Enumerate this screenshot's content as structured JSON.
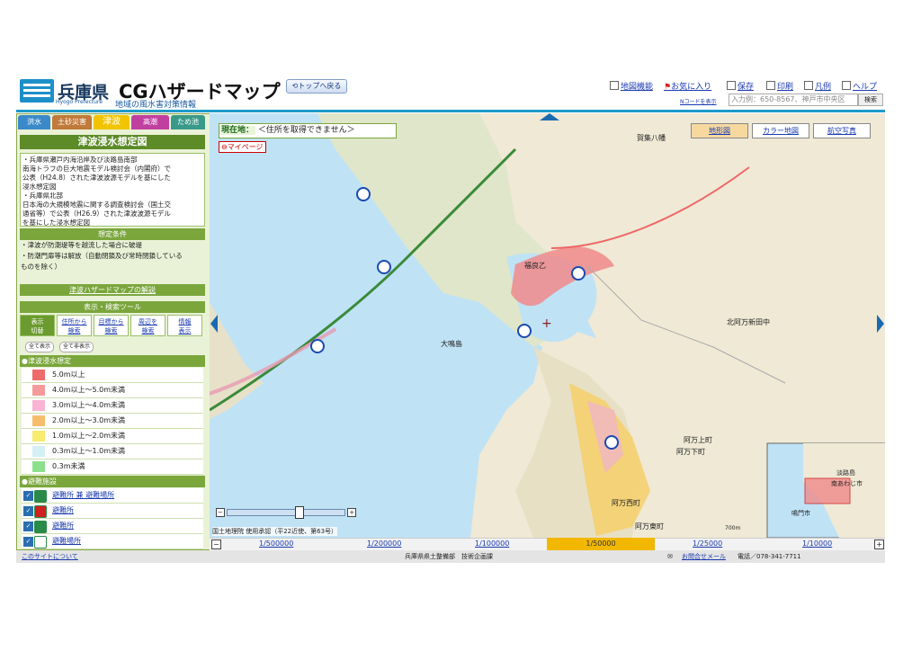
{
  "header": {
    "pref_name": "兵庫県",
    "app_title": "CGハザードマップ",
    "app_subtitle": "地域の風水害対策情報",
    "hyogo_en": "Hyogo Prefecture",
    "top_button": "トップへ戻る",
    "menu": [
      "地図機能",
      "お気に入り",
      "保存",
      "印刷",
      "凡例",
      "ヘルプ"
    ],
    "ncode_link": "Nコードを表示",
    "address_placeholder": "入力例：650-8567、神戸市中央区",
    "search_button": "検索"
  },
  "hazard_tabs": [
    "洪水",
    "土砂災害",
    "津波",
    "高潮",
    "ため池"
  ],
  "panel": {
    "title": "津波浸水想定図",
    "description": [
      "・兵庫県瀬戸内海沿岸及び淡路島南部",
      "南海トラフの巨大地震モデル検討会（内閣府）で",
      "公表（H24.8）された津波波源モデルを基にした",
      "浸水想定図",
      "・兵庫県北部",
      "日本海の大規模地震に関する調査検討会（国土交",
      "通省等）で公表（H26.9）された津波波源モデル",
      "を基にした浸水想定図"
    ],
    "conditions_header": "想定条件",
    "conditions": [
      "・津波が防潮堤等を越流した場合に破堤",
      "・防潮門扉等は解放（自動閉鎖及び常時閉鎖している",
      "ものを除く）"
    ],
    "explain_link": "津波ハザードマップの解説",
    "tools_header": "表示・検索ツール",
    "tools": [
      "表示\n切替",
      "住所から\n検索",
      "目標から\n検索",
      "周辺を\n検索",
      "情報\n表示"
    ],
    "show_all": "全て表示",
    "hide_all": "全て非表示",
    "legend_title": "●津波浸水想定",
    "legend": [
      {
        "label": "5.0m以上",
        "color": "#ee6b6b"
      },
      {
        "label": "4.0m以上～5.0m未満",
        "color": "#f59a9a"
      },
      {
        "label": "3.0m以上～4.0m未満",
        "color": "#f8b4d2"
      },
      {
        "label": "2.0m以上～3.0m未満",
        "color": "#f6be6c"
      },
      {
        "label": "1.0m以上～2.0m未満",
        "color": "#f7ec6e"
      },
      {
        "label": "0.3m以上～1.0m未満",
        "color": "#d4f0f4"
      },
      {
        "label": "0.3m未満",
        "color": "#8ce08c"
      }
    ],
    "shelter_title": "●避難施設",
    "shelters": [
      {
        "label": "避難所 兼 避難場所",
        "icon": "shelter-both-icon",
        "color": "#2a8a4a"
      },
      {
        "label": "避難所",
        "icon": "shelter-red-icon",
        "color": "#d02020"
      },
      {
        "label": "避難所",
        "icon": "shelter-icon",
        "color": "#2a8a4a"
      },
      {
        "label": "避難場所",
        "icon": "evacuation-site-icon",
        "color": "#ffffff"
      }
    ]
  },
  "map": {
    "location_label": "現在地：",
    "location_value": "＜住所を取得できません＞",
    "mypage": "マイページ",
    "map_types": [
      "地形図",
      "カラー地図",
      "航空写真"
    ],
    "active_map_type": "地形図",
    "credit": "国土地理院 使用承認（平22近使、第63号）",
    "scale_label": "700m",
    "place_labels": [
      "福良乙",
      "阿万上町",
      "阿万下町",
      "阿万西町",
      "阿万東町",
      "賀集八幡",
      "北阿万新田中",
      "大鳴島",
      "淡路島",
      "鳴門市",
      "南あわじ市"
    ]
  },
  "scales": [
    "1/500000",
    "1/200000",
    "1/100000",
    "1/50000",
    "1/25000",
    "1/10000"
  ],
  "active_scale": "1/50000",
  "footer": {
    "about": "このサイトについて",
    "dept": "兵庫県県土整備部　技術企画課",
    "contact": "お問合せメール",
    "phone": "電話／078-341-7711"
  }
}
